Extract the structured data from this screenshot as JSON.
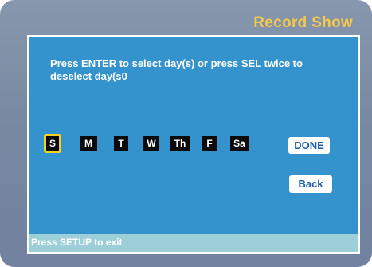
{
  "screen": {
    "title": "Record Show",
    "instruction": "Press ENTER to select day(s) or press SEL twice to deselect day(s0",
    "footer": "Press SETUP to exit"
  },
  "days": [
    {
      "label": "S",
      "selected": true
    },
    {
      "label": "M",
      "selected": false
    },
    {
      "label": "T",
      "selected": false
    },
    {
      "label": "W",
      "selected": false
    },
    {
      "label": "Th",
      "selected": false
    },
    {
      "label": "F",
      "selected": false
    },
    {
      "label": "Sa",
      "selected": false
    }
  ],
  "buttons": {
    "done": "DONE",
    "back": "Back"
  },
  "colors": {
    "title": "#f4c74d",
    "panel": "#3493cd",
    "selected_outline": "#f4d21a",
    "button_text": "#1f5fae"
  }
}
